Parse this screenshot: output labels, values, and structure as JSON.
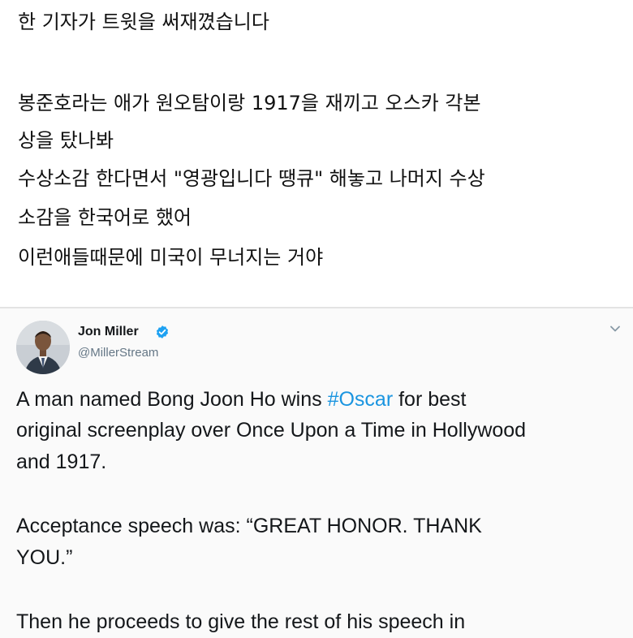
{
  "post": {
    "lines": [
      "한 기자가 트윗을 써재꼈습니다",
      "봉준호라는 애가 원오탐이랑 1917을 재끼고 오스카 각본",
      "상을 탔나봐",
      "수상소감 한다면서 \"영광입니다 땡큐\" 해놓고 나머지 수상",
      "소감을 한국어로 했어",
      "이런애들때문에 미국이 무너지는 거야"
    ]
  },
  "tweet": {
    "author_name": "Jon Miller",
    "handle": "@MillerStream",
    "text": {
      "line1_before": "A man named Bong Joon Ho wins ",
      "hashtag": "#Oscar",
      "line1_after": " for best",
      "line2": "original screenplay over Once Upon a Time in Hollywood",
      "line3": "and 1917.",
      "line4": "Acceptance speech was: “GREAT HONOR. THANK",
      "line5": "YOU.”",
      "line6": "Then he proceeds to give the rest of his speech in"
    },
    "icons": {
      "verified": "verified-badge-icon",
      "menu": "chevron-down-icon"
    },
    "colors": {
      "hashtag": "#1b95e0",
      "verified": "#1da1f2",
      "handle": "#657786"
    }
  }
}
